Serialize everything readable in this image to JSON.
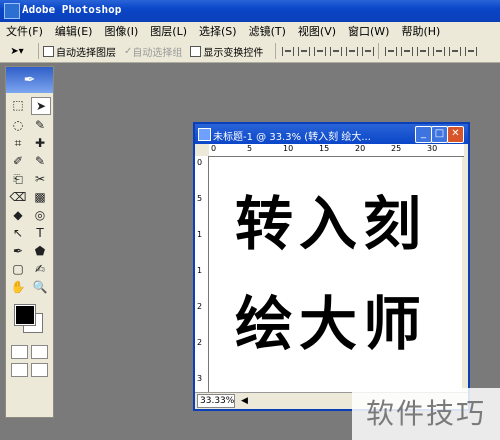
{
  "app": {
    "title": "Adobe Photoshop"
  },
  "menu": [
    "文件(F)",
    "编辑(E)",
    "图像(I)",
    "图层(L)",
    "选择(S)",
    "滤镜(T)",
    "视图(V)",
    "窗口(W)",
    "帮助(H)"
  ],
  "options": {
    "auto_select_layer": "自动选择图层",
    "auto_select_group": "自动选择组",
    "show_transform": "显示变换控件"
  },
  "toolbox": {
    "tools": [
      "⬚",
      "➤",
      "◌",
      "✎",
      "⌗",
      "✚",
      "✐",
      "✎",
      "⎗",
      "✂",
      "⌫",
      "▩",
      "◆",
      "◎",
      "↖",
      "T",
      "✒",
      "⬟",
      "▢",
      "✍",
      "✋",
      "🔍"
    ]
  },
  "document": {
    "title": "未标题-1 @ 33.3% (转入刻 绘大...",
    "ruler_h": [
      "0",
      "5",
      "10",
      "15",
      "20",
      "25",
      "30"
    ],
    "ruler_v": [
      "0",
      "5",
      "1",
      "1",
      "2",
      "2",
      "3"
    ],
    "line1": "转入刻",
    "line2": "绘大师",
    "zoom": "33.33%"
  },
  "watermark": "软件技巧"
}
